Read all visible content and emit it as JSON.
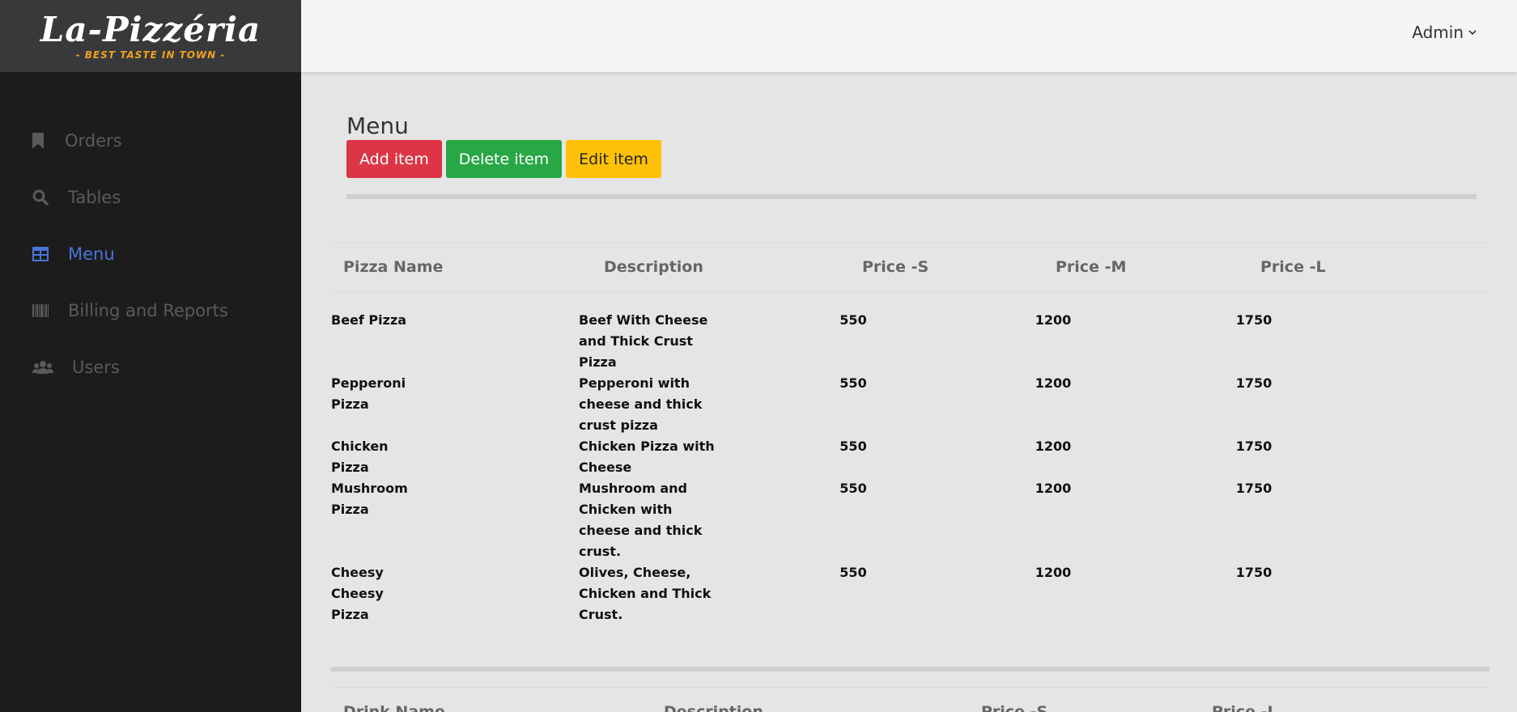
{
  "brand": {
    "name": "La-Pizzéria",
    "tagline": "- BEST TASTE IN TOWN -"
  },
  "sidebar": {
    "items": [
      {
        "label": "Orders",
        "icon": "bookmark-icon"
      },
      {
        "label": "Tables",
        "icon": "search-icon"
      },
      {
        "label": "Menu",
        "icon": "table-icon",
        "active": true
      },
      {
        "label": "Billing and Reports",
        "icon": "barcode-icon"
      },
      {
        "label": "Users",
        "icon": "users-icon"
      }
    ]
  },
  "header": {
    "user": "Admin"
  },
  "main": {
    "title": "Menu",
    "buttons": {
      "add": "Add item",
      "delete": "Delete item",
      "edit": "Edit item"
    },
    "pizza_table": {
      "columns": [
        "Pizza Name",
        "Description",
        "Price -S",
        "Price -M",
        "Price -L"
      ],
      "rows": [
        {
          "name": "Beef Pizza",
          "description": "Beef With Cheese and Thick Crust Pizza",
          "s": "550",
          "m": "1200",
          "l": "1750"
        },
        {
          "name": "Pepperoni Pizza",
          "description": "Pepperoni with cheese and thick crust pizza",
          "s": "550",
          "m": "1200",
          "l": "1750"
        },
        {
          "name": "Chicken Pizza",
          "description": "Chicken Pizza with Cheese",
          "s": "550",
          "m": "1200",
          "l": "1750"
        },
        {
          "name": "Mushroom Pizza",
          "description": "Mushroom and Chicken with cheese and thick crust.",
          "s": "550",
          "m": "1200",
          "l": "1750"
        },
        {
          "name": "Cheesy Cheesy Pizza",
          "description": "Olives, Cheese, Chicken and Thick Crust.",
          "s": "550",
          "m": "1200",
          "l": "1750"
        }
      ]
    },
    "drink_table": {
      "columns": [
        "Drink Name",
        "Description",
        "Price -S",
        "Price -L"
      ]
    }
  },
  "colors": {
    "sidebar_bg": "#1c1c1c",
    "active": "#4a74d9",
    "add": "#dc3545",
    "delete": "#28a745",
    "edit": "#ffc107"
  }
}
